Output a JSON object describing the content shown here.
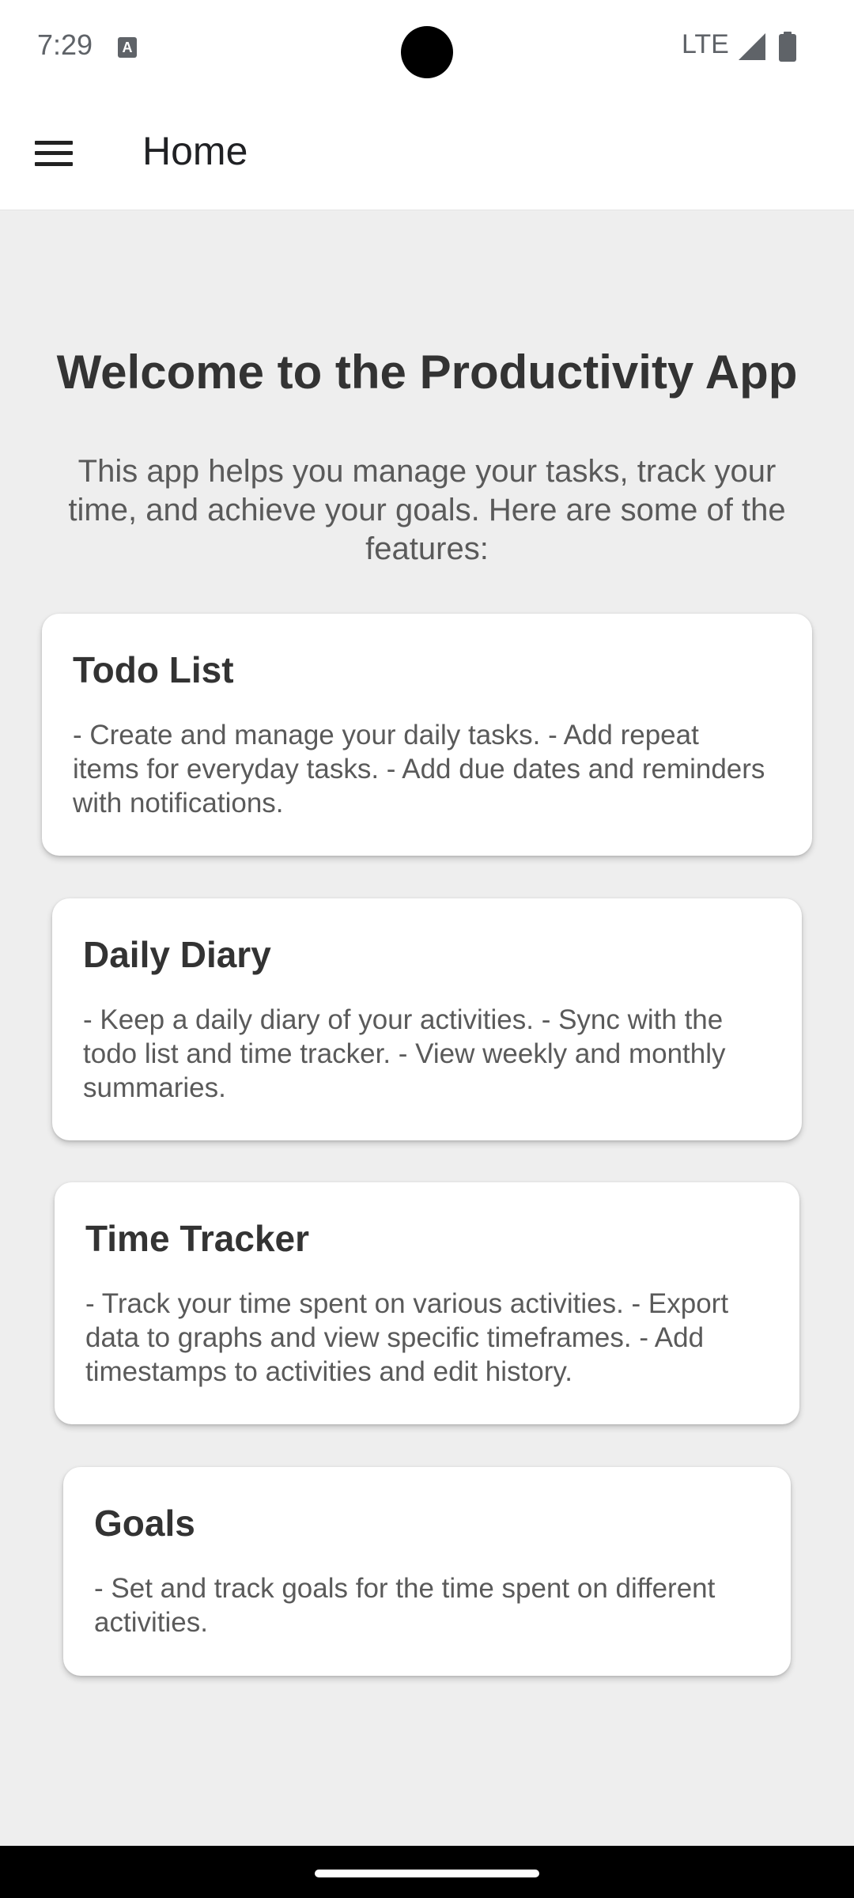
{
  "status_bar": {
    "time": "7:29",
    "network": "LTE",
    "notification_icon": "a-icon",
    "signal_icon": "signal-icon",
    "battery_icon": "battery-icon"
  },
  "app_bar": {
    "title": "Home",
    "menu_icon": "menu-icon"
  },
  "main": {
    "title": "Welcome to the Productivity App",
    "intro": "This app helps you manage your tasks, track your time, and achieve your goals. Here are some of the features:",
    "cards": [
      {
        "title": "Todo List",
        "body": "- Create and manage your daily tasks. - Add repeat items for everyday tasks. - Add due dates and reminders with notifications."
      },
      {
        "title": "Daily Diary",
        "body": "- Keep a daily diary of your activities. - Sync with the todo list and time tracker. - View weekly and monthly summaries."
      },
      {
        "title": "Time Tracker",
        "body": "- Track your time spent on various activities. - Export data to graphs and view specific timeframes. - Add timestamps to activities and edit history."
      },
      {
        "title": "Goals",
        "body": "- Set and track goals for the time spent on different activities."
      }
    ]
  },
  "colors": {
    "background": "#eeeeee",
    "card": "#ffffff",
    "title_text": "#333333",
    "body_text": "#5a5a5a"
  }
}
